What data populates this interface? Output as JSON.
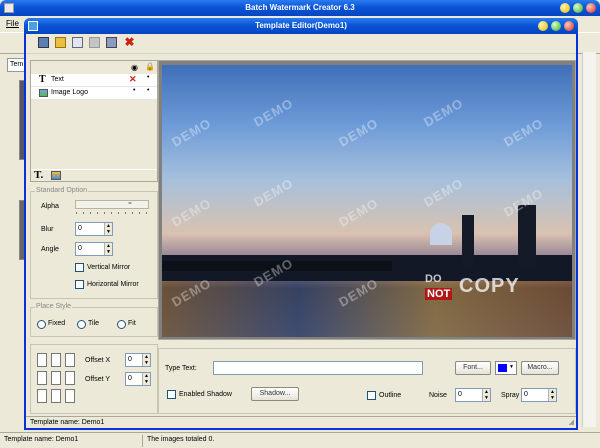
{
  "back_window": {
    "title": "Batch Watermark Creator 6.3",
    "menu": {
      "file": "File"
    },
    "tab_fragment": "Tem",
    "status": {
      "template": "Template name: Demo1",
      "total": "The images totaled 0."
    }
  },
  "editor": {
    "title": "Template Editor(Demo1)",
    "layers": [
      {
        "name": "Text",
        "icon": "text-icon"
      },
      {
        "name": "Image Logo",
        "icon": "image-icon"
      }
    ],
    "standard_option": {
      "group": "Standard Option",
      "alpha_label": "Alpha",
      "blur_label": "Blur",
      "blur_value": "0",
      "angle_label": "Angle",
      "angle_value": "0",
      "vertical_mirror": "Vertical Mirror",
      "horizontal_mirror": "Horizontal Mirror"
    },
    "place_style": {
      "group": "Place Style",
      "options": [
        "Fixed",
        "Tile",
        "Fit"
      ]
    },
    "offset": {
      "x_label": "Offset X",
      "x_value": "0",
      "y_label": "Offset Y",
      "y_value": "0"
    },
    "text_controls": {
      "type_text_label": "Type Text:",
      "type_text_value": "",
      "font_button": "Font...",
      "macro_button": "Macro...",
      "color": "#0000ff",
      "shadow_label": "Enabled Shadow",
      "shadow_button": "Shadow...",
      "outline_label": "Outline",
      "noise_label": "Noise",
      "noise_value": "0",
      "spray_label": "Spray",
      "spray_value": "0"
    },
    "preview": {
      "watermark_text": "DEMO",
      "logo_line1": "DO",
      "logo_line2": "NOT",
      "logo_word": "COPY"
    },
    "status": "Template name: Demo1"
  }
}
